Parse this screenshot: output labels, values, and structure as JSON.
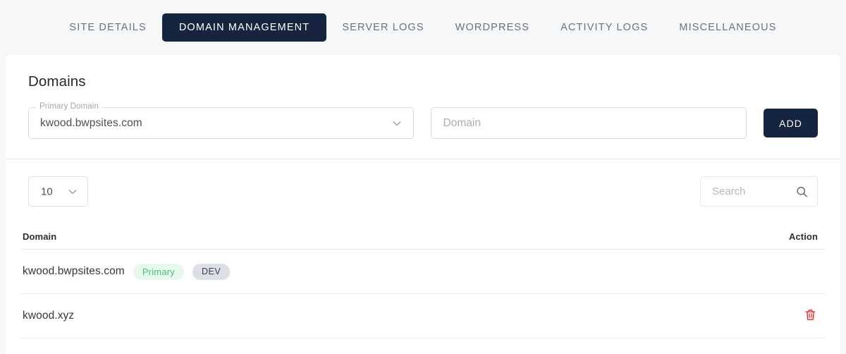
{
  "tabs": [
    {
      "label": "SITE DETAILS",
      "active": false
    },
    {
      "label": "DOMAIN MANAGEMENT",
      "active": true
    },
    {
      "label": "SERVER LOGS",
      "active": false
    },
    {
      "label": "WORDPRESS",
      "active": false
    },
    {
      "label": "ACTIVITY LOGS",
      "active": false
    },
    {
      "label": "MISCELLANEOUS",
      "active": false
    }
  ],
  "page": {
    "title": "Domains"
  },
  "form": {
    "primary_domain_label": "Primary Domain",
    "primary_domain_value": "kwood.bwpsites.com",
    "domain_placeholder": "Domain",
    "domain_value": "",
    "add_label": "ADD"
  },
  "toolbar": {
    "rows_per_page": "10",
    "search_placeholder": "Search",
    "search_value": ""
  },
  "table": {
    "columns": {
      "domain": "Domain",
      "action": "Action"
    },
    "rows": [
      {
        "domain": "kwood.bwpsites.com",
        "badges": [
          {
            "label": "Primary",
            "kind": "primary"
          },
          {
            "label": "DEV",
            "kind": "dev"
          }
        ],
        "deletable": false
      },
      {
        "domain": "kwood.xyz",
        "badges": [],
        "deletable": true
      }
    ]
  },
  "colors": {
    "accent_navy": "#16253f",
    "page_bg": "#f6f7f9",
    "badge_primary_bg": "#e7f8ed",
    "badge_primary_text": "#49c07c",
    "badge_dev_bg": "#dcdfe6",
    "delete_icon": "#f01b1b"
  },
  "icons": {
    "chevron_down": "chevron-down-icon",
    "search": "search-icon",
    "delete": "trash-icon"
  }
}
